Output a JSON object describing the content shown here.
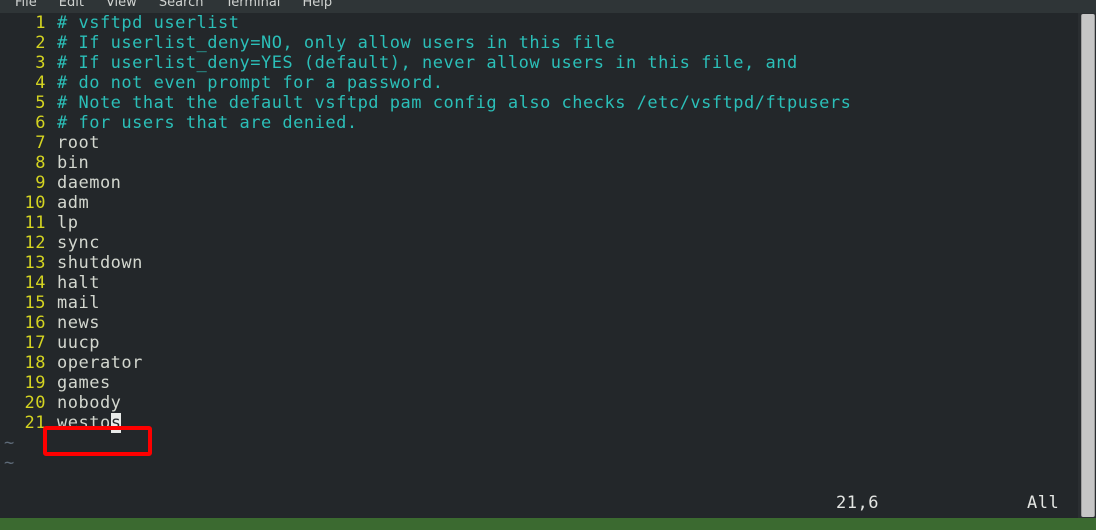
{
  "menubar": {
    "items": [
      {
        "label": "File"
      },
      {
        "label": "Edit"
      },
      {
        "label": "View"
      },
      {
        "label": "Search"
      },
      {
        "label": "Terminal"
      },
      {
        "label": "Help"
      }
    ]
  },
  "editor": {
    "lines": [
      {
        "num": "1",
        "text": "# vsftpd userlist",
        "kind": "comment"
      },
      {
        "num": "2",
        "text": "# If userlist_deny=NO, only allow users in this file",
        "kind": "comment"
      },
      {
        "num": "3",
        "text": "# If userlist_deny=YES (default), never allow users in this file, and",
        "kind": "comment"
      },
      {
        "num": "4",
        "text": "# do not even prompt for a password.",
        "kind": "comment"
      },
      {
        "num": "5",
        "text": "# Note that the default vsftpd pam config also checks /etc/vsftpd/ftpusers",
        "kind": "comment"
      },
      {
        "num": "6",
        "text": "# for users that are denied.",
        "kind": "comment"
      },
      {
        "num": "7",
        "text": "root",
        "kind": "plain"
      },
      {
        "num": "8",
        "text": "bin",
        "kind": "plain"
      },
      {
        "num": "9",
        "text": "daemon",
        "kind": "plain"
      },
      {
        "num": "10",
        "text": "adm",
        "kind": "plain"
      },
      {
        "num": "11",
        "text": "lp",
        "kind": "plain"
      },
      {
        "num": "12",
        "text": "sync",
        "kind": "plain"
      },
      {
        "num": "13",
        "text": "shutdown",
        "kind": "plain"
      },
      {
        "num": "14",
        "text": "halt",
        "kind": "plain"
      },
      {
        "num": "15",
        "text": "mail",
        "kind": "plain"
      },
      {
        "num": "16",
        "text": "news",
        "kind": "plain"
      },
      {
        "num": "17",
        "text": "uucp",
        "kind": "plain"
      },
      {
        "num": "18",
        "text": "operator",
        "kind": "plain"
      },
      {
        "num": "19",
        "text": "games",
        "kind": "plain"
      },
      {
        "num": "20",
        "text": "nobody",
        "kind": "plain"
      }
    ],
    "cursor_line": {
      "num": "21",
      "before": "westo",
      "cursor_char": "s",
      "kind": "plain"
    },
    "empty_markers": [
      "~",
      "~"
    ]
  },
  "statusline": {
    "position": "21,6",
    "scroll": "All"
  },
  "annotation": {
    "shape": "rectangle",
    "color": "#fe0000",
    "target_text": "westos"
  },
  "colors": {
    "background": "#23272a",
    "menubar_bg": "#2f3537",
    "comment_text": "#2bbfb8",
    "plain_text": "#d3d7cf",
    "line_number": "#d4d421",
    "tilde": "#5d6a78",
    "status_text": "#e4e6e3",
    "scrollbar_thumb": "#c6c6c6",
    "desktop_strip": "#3b6a30",
    "annotation": "#fe0000"
  }
}
